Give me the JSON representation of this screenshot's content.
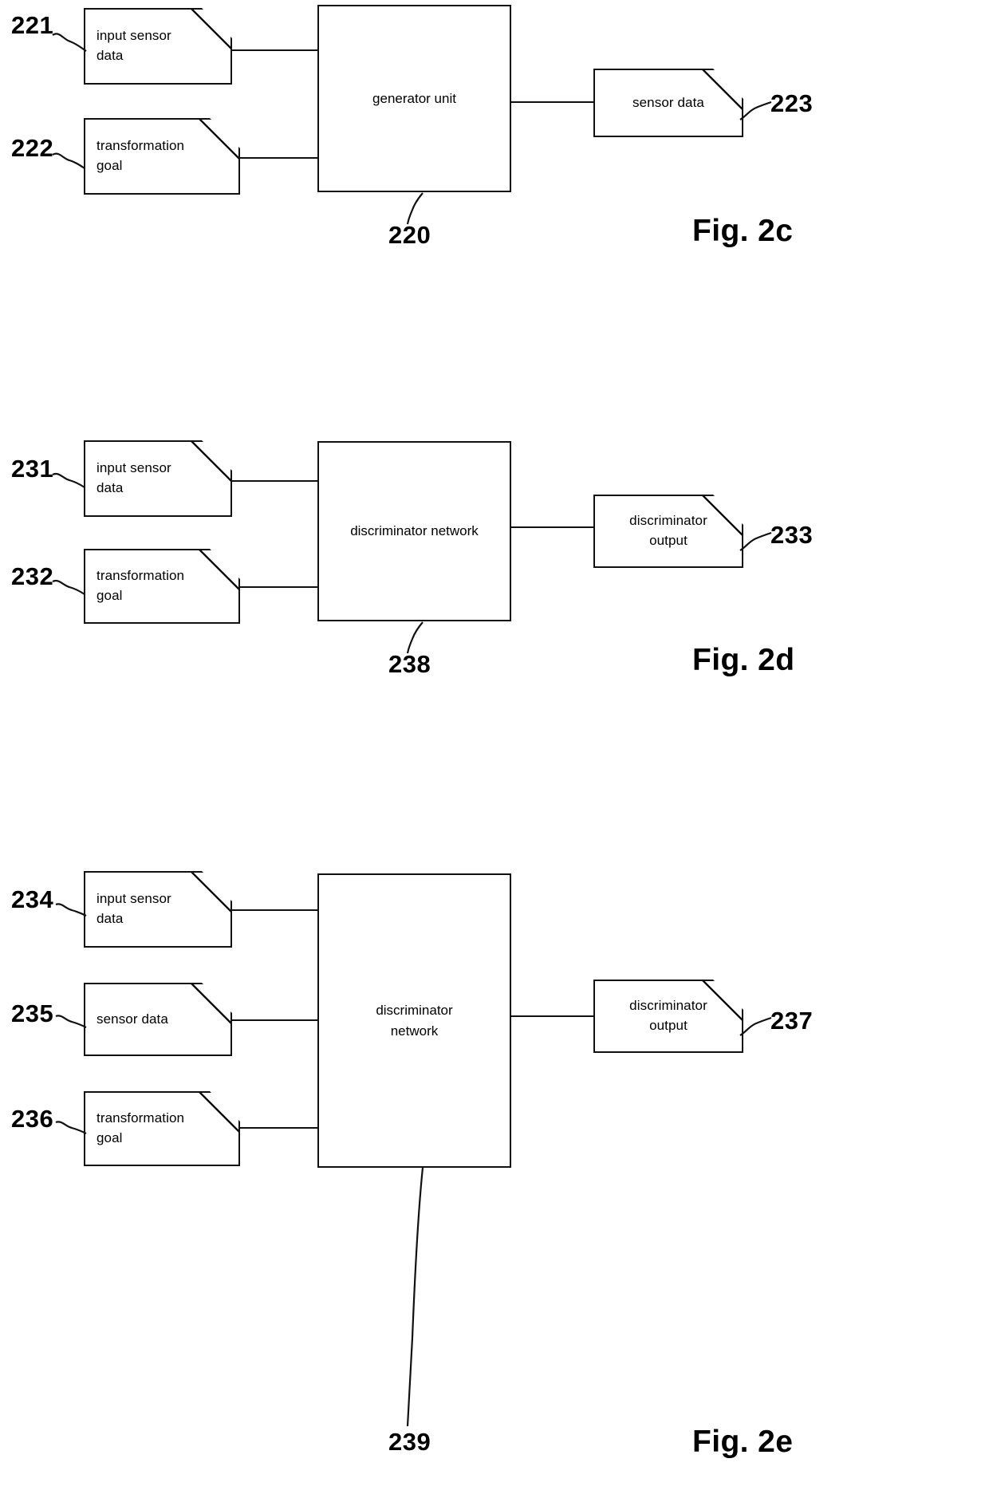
{
  "document": {
    "kind": "patent-drawing-sheet",
    "figures": [
      {
        "id": "fig-2c",
        "caption": "Fig. 2c",
        "inputs": [
          {
            "ref": "221",
            "label": "input sensor\ndata"
          },
          {
            "ref": "222",
            "label": "transformation\ngoal"
          }
        ],
        "unit": {
          "ref": "220",
          "label": "generator unit"
        },
        "outputs": [
          {
            "ref": "223",
            "label": "sensor data"
          }
        ]
      },
      {
        "id": "fig-2d",
        "caption": "Fig. 2d",
        "inputs": [
          {
            "ref": "231",
            "label": "input sensor\ndata"
          },
          {
            "ref": "232",
            "label": "transformation\ngoal"
          }
        ],
        "unit": {
          "ref": "238",
          "label": "discriminator network"
        },
        "outputs": [
          {
            "ref": "233",
            "label": "discriminator\noutput"
          }
        ]
      },
      {
        "id": "fig-2e",
        "caption": "Fig. 2e",
        "inputs": [
          {
            "ref": "234",
            "label": "input sensor\ndata"
          },
          {
            "ref": "235",
            "label": "sensor data"
          },
          {
            "ref": "236",
            "label": "transformation\ngoal"
          }
        ],
        "unit": {
          "ref": "239",
          "label": "discriminator\nnetwork"
        },
        "outputs": [
          {
            "ref": "237",
            "label": "discriminator\noutput"
          }
        ]
      }
    ],
    "text": {
      "fig2c": {
        "ref_221": "221",
        "ref_222": "222",
        "ref_220": "220",
        "ref_223": "223",
        "box_221_line1": "input sensor",
        "box_221_line2": "data",
        "box_222_line1": "transformation",
        "box_222_line2": "goal",
        "unit_220": "generator unit",
        "box_223": "sensor data",
        "caption": "Fig. 2c"
      },
      "fig2d": {
        "ref_231": "231",
        "ref_232": "232",
        "ref_238": "238",
        "ref_233": "233",
        "box_231_line1": "input sensor",
        "box_231_line2": "data",
        "box_232_line1": "transformation",
        "box_232_line2": "goal",
        "unit_238": "discriminator network",
        "box_233_line1": "discriminator",
        "box_233_line2": "output",
        "caption": "Fig. 2d"
      },
      "fig2e": {
        "ref_234": "234",
        "ref_235": "235",
        "ref_236": "236",
        "ref_239": "239",
        "ref_237": "237",
        "box_234_line1": "input sensor",
        "box_234_line2": "data",
        "box_235": "sensor data",
        "box_236_line1": "transformation",
        "box_236_line2": "goal",
        "unit_239_line1": "discriminator",
        "unit_239_line2": "network",
        "box_237_line1": "discriminator",
        "box_237_line2": "output",
        "caption": "Fig. 2e"
      }
    },
    "colors": {
      "ink": "#111111",
      "paper": "#ffffff"
    }
  }
}
